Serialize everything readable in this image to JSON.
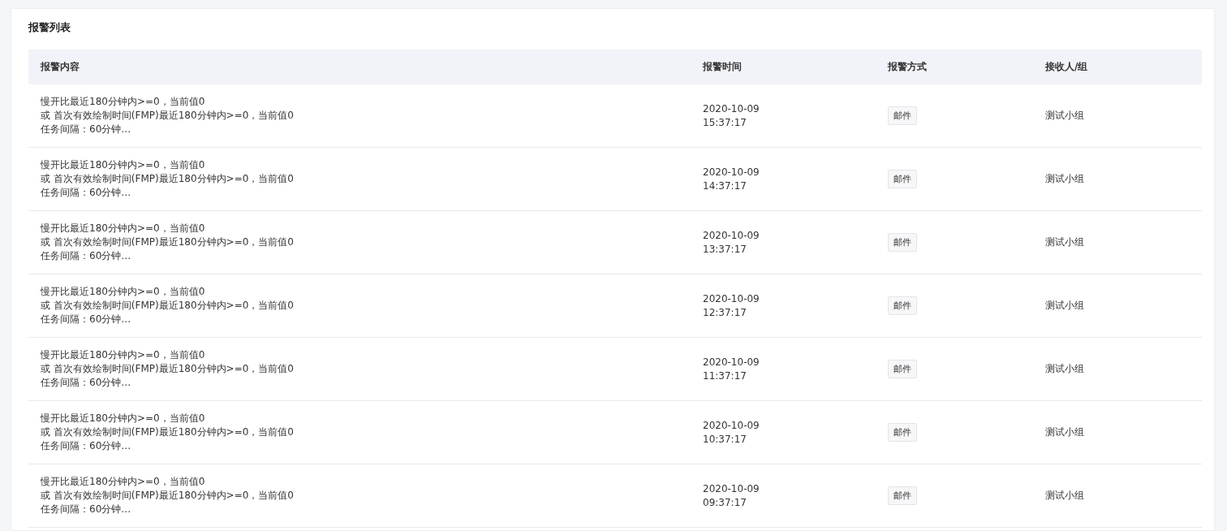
{
  "title": "报警列表",
  "table": {
    "columns": [
      "报警内容",
      "报警时间",
      "报警方式",
      "接收人/组"
    ],
    "rows": [
      {
        "content": [
          "慢开比最近180分钟内>=0，当前值0",
          "或 首次有效绘制时间(FMP)最近180分钟内>=0，当前值0",
          "任务间隔：60分钟…"
        ],
        "date": "2020-10-09",
        "time": "15:37:17",
        "method": "邮件",
        "receiver": "测试小组"
      },
      {
        "content": [
          "慢开比最近180分钟内>=0，当前值0",
          "或 首次有效绘制时间(FMP)最近180分钟内>=0，当前值0",
          "任务间隔：60分钟…"
        ],
        "date": "2020-10-09",
        "time": "14:37:17",
        "method": "邮件",
        "receiver": "测试小组"
      },
      {
        "content": [
          "慢开比最近180分钟内>=0，当前值0",
          "或 首次有效绘制时间(FMP)最近180分钟内>=0，当前值0",
          "任务间隔：60分钟…"
        ],
        "date": "2020-10-09",
        "time": "13:37:17",
        "method": "邮件",
        "receiver": "测试小组"
      },
      {
        "content": [
          "慢开比最近180分钟内>=0，当前值0",
          "或 首次有效绘制时间(FMP)最近180分钟内>=0，当前值0",
          "任务间隔：60分钟…"
        ],
        "date": "2020-10-09",
        "time": "12:37:17",
        "method": "邮件",
        "receiver": "测试小组"
      },
      {
        "content": [
          "慢开比最近180分钟内>=0，当前值0",
          "或 首次有效绘制时间(FMP)最近180分钟内>=0，当前值0",
          "任务间隔：60分钟…"
        ],
        "date": "2020-10-09",
        "time": "11:37:17",
        "method": "邮件",
        "receiver": "测试小组"
      },
      {
        "content": [
          "慢开比最近180分钟内>=0，当前值0",
          "或 首次有效绘制时间(FMP)最近180分钟内>=0，当前值0",
          "任务间隔：60分钟…"
        ],
        "date": "2020-10-09",
        "time": "10:37:17",
        "method": "邮件",
        "receiver": "测试小组"
      },
      {
        "content": [
          "慢开比最近180分钟内>=0，当前值0",
          "或 首次有效绘制时间(FMP)最近180分钟内>=0，当前值0",
          "任务间隔：60分钟…"
        ],
        "date": "2020-10-09",
        "time": "09:37:17",
        "method": "邮件",
        "receiver": "测试小组"
      }
    ]
  }
}
